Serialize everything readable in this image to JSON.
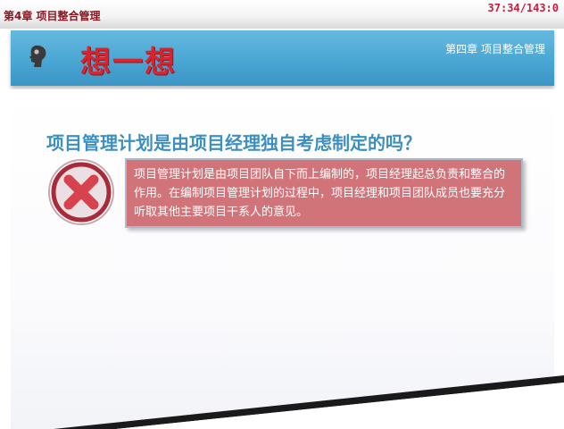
{
  "topbar": {
    "chapter_label": "第4章 项目整合管理",
    "timer": "37:34/143:0"
  },
  "header": {
    "icon": "thinking-head-icon",
    "title": "想一想",
    "chapter": "第四章  项目整合管理"
  },
  "main": {
    "question": "项目管理计划是由项目经理独自考虑制定的吗？",
    "verdict_icon": "x-mark-icon",
    "answer": "项目管理计划是由项目团队自下而上编制的，项目经理起总负责和整合的作用。在编制项目管理计划的过程中，项目经理和项目团队成员也要充分听取其他主要项目干系人的意见。"
  },
  "colors": {
    "header_band": "#4aa6d3",
    "title_red": "#d8242e",
    "question_blue": "#3c8fbf",
    "answer_box": "#d1747a",
    "timer_red": "#d01a3a"
  }
}
